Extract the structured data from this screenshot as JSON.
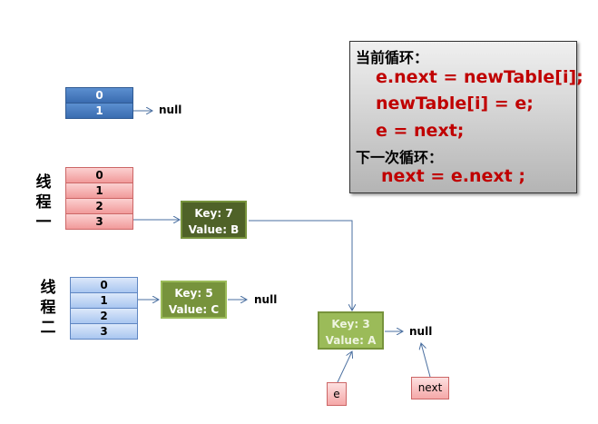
{
  "top_table": {
    "rows": [
      "0",
      "1"
    ],
    "null": "null"
  },
  "thread1": {
    "label": [
      "线",
      "程",
      "一"
    ],
    "rows": [
      "0",
      "1",
      "2",
      "3"
    ]
  },
  "thread2": {
    "label": [
      "线",
      "程",
      "二"
    ],
    "rows": [
      "0",
      "1",
      "2",
      "3"
    ]
  },
  "nodes": {
    "n7": {
      "key": "Key: 7",
      "value": "Value: B"
    },
    "n5": {
      "key": "Key: 5",
      "value": "Value: C",
      "null": "null"
    },
    "n3": {
      "key": "Key: 3",
      "value": "Value: A",
      "null": "null"
    }
  },
  "pointers": {
    "e": "e",
    "next": "next"
  },
  "code": {
    "current_title": "当前循环：",
    "line1": "e.next = newTable[i];",
    "line2": "newTable[i] = e;",
    "line3": "e = next;",
    "next_title": "下一次循环：",
    "line4": "next = e.next ;"
  }
}
